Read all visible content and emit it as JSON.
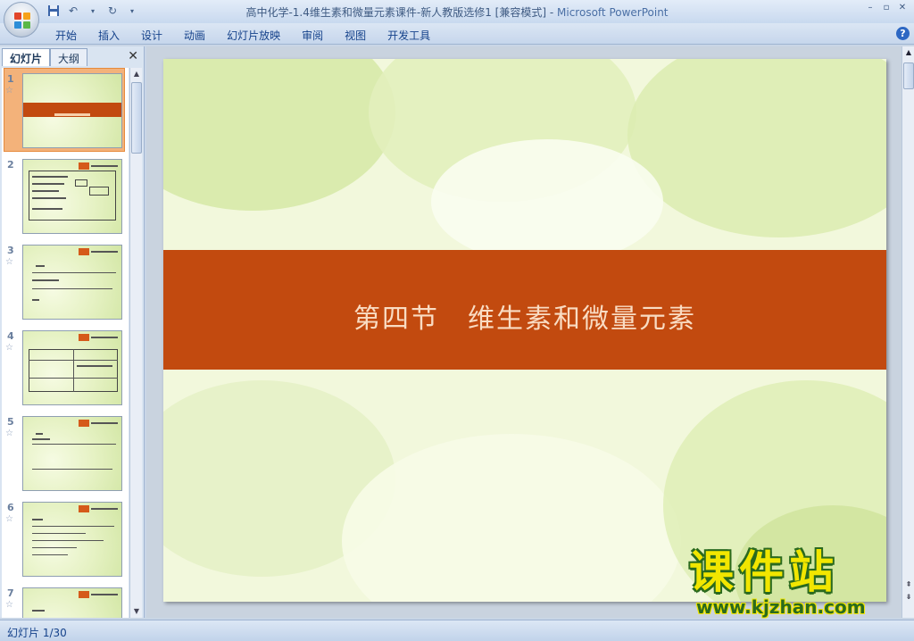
{
  "window": {
    "title": "高中化学-1.4维生素和微量元素课件-新人教版选修1 [兼容模式]",
    "app_name": "Microsoft PowerPoint",
    "minimize_glyph": "–",
    "restore_glyph": "▫",
    "close_glyph": "✕"
  },
  "quick_access": {
    "save_icon": "save-icon",
    "undo_icon": "undo-icon",
    "redo_icon": "redo-icon"
  },
  "ribbon": {
    "tabs": [
      "开始",
      "插入",
      "设计",
      "动画",
      "幻灯片放映",
      "审阅",
      "视图",
      "开发工具"
    ],
    "help_label": "?"
  },
  "left_panel": {
    "tabs": [
      "幻灯片",
      "大纲"
    ],
    "close_glyph": "✕",
    "slides": [
      {
        "number": "1",
        "selected": true
      },
      {
        "number": "2",
        "selected": false
      },
      {
        "number": "3",
        "selected": false
      },
      {
        "number": "4",
        "selected": false
      },
      {
        "number": "5",
        "selected": false
      },
      {
        "number": "6",
        "selected": false
      },
      {
        "number": "7",
        "selected": false
      }
    ],
    "star_glyph": "☆"
  },
  "slide": {
    "title": "第四节　维生素和微量元素",
    "band_color": "#c24a0f",
    "title_color": "#f9dcc3"
  },
  "status": {
    "slide_indicator": "幻灯片 1/30"
  },
  "watermark": {
    "big": "课件站",
    "small": "www.kjzhan.com"
  }
}
